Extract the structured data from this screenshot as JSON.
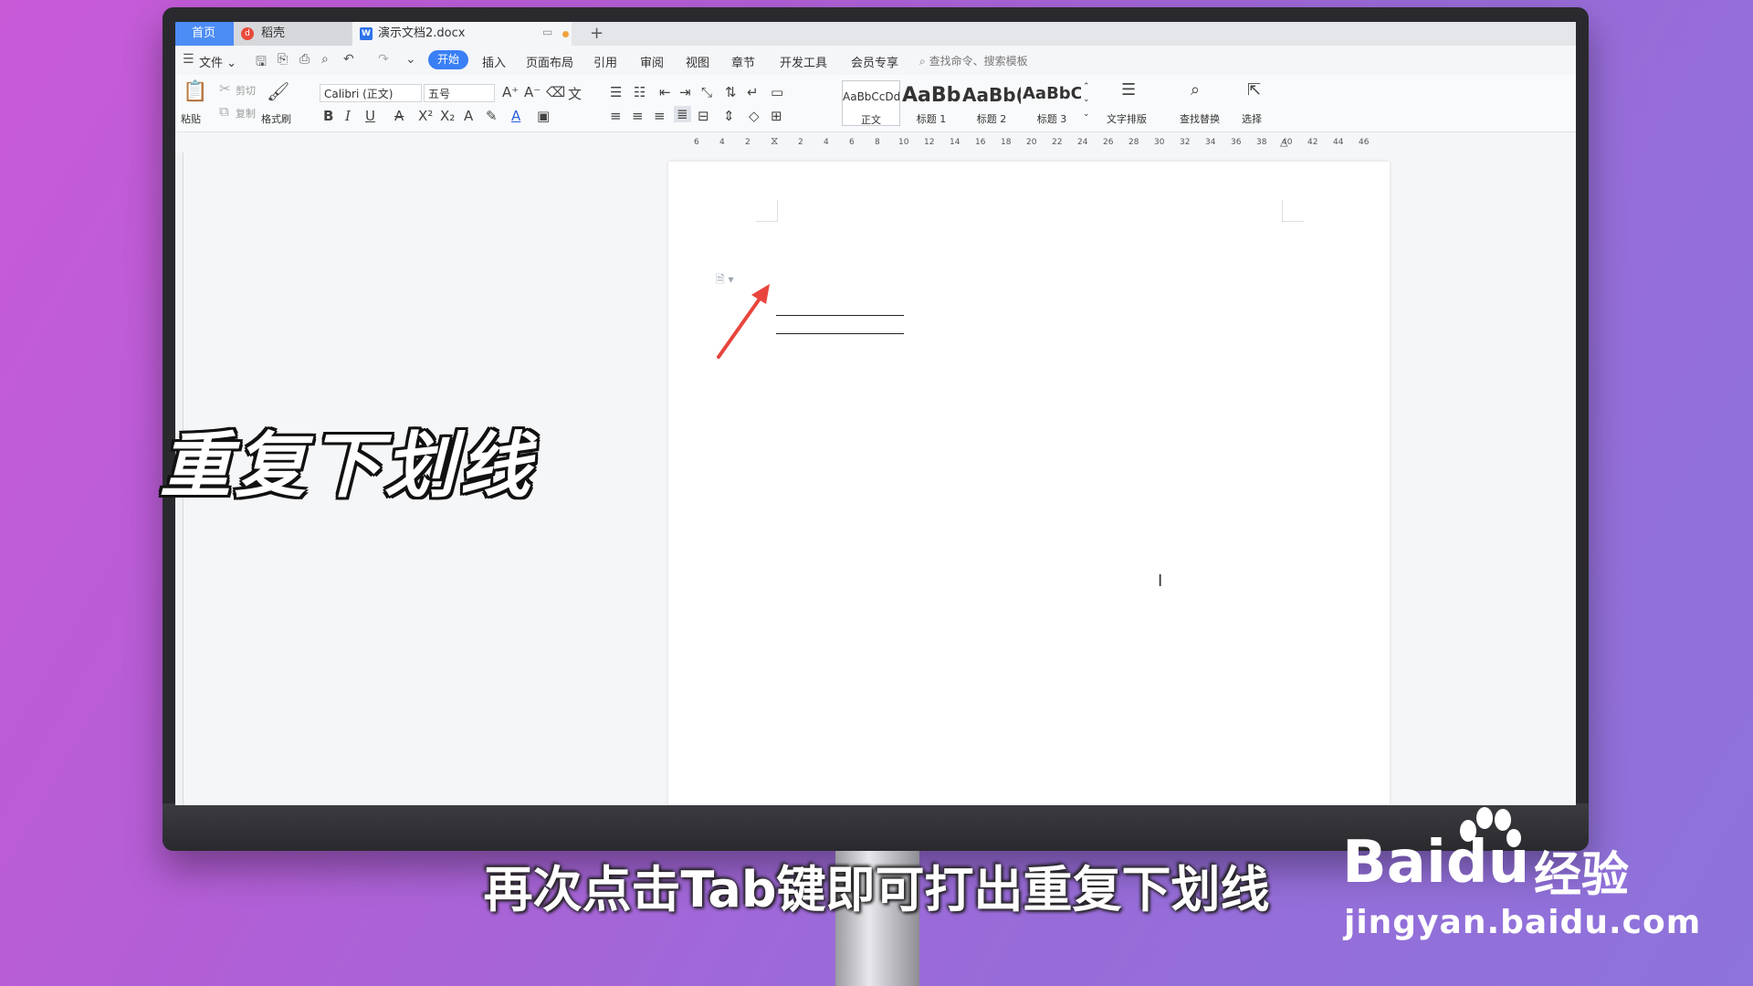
{
  "tabs": {
    "home": "首页",
    "daoke": "稻壳",
    "document": "演示文档2.docx"
  },
  "menu": {
    "file": "文件",
    "items": [
      "开始",
      "插入",
      "页面布局",
      "引用",
      "审阅",
      "视图",
      "章节",
      "开发工具",
      "会员专享"
    ],
    "search_placeholder": "查找命令、搜索模板"
  },
  "ribbon": {
    "paste": "粘贴",
    "cut": "剪切",
    "copy": "复制",
    "format_painter": "格式刷",
    "font_name": "Calibri (正文)",
    "font_size": "五号",
    "styles": [
      {
        "preview": "AaBbCcDd",
        "label": "正文"
      },
      {
        "preview": "AaBb",
        "label": "标题 1"
      },
      {
        "preview": "AaBb(",
        "label": "标题 2"
      },
      {
        "preview": "AaBbC(",
        "label": "标题 3"
      }
    ],
    "text_layout": "文字排版",
    "find_replace": "查找替换",
    "select": "选择"
  },
  "ruler": {
    "numbers": [
      "6",
      "4",
      "2",
      "2",
      "4",
      "6",
      "8",
      "10",
      "12",
      "14",
      "16",
      "18",
      "20",
      "22",
      "24",
      "26",
      "28",
      "30",
      "32",
      "34",
      "36",
      "38",
      "40",
      "42",
      "44",
      "46"
    ]
  },
  "overlay": {
    "title": "重复下划线",
    "subtitle": "再次点击Tab键即可打出重复下划线"
  },
  "watermark": {
    "brand": "Bai",
    "brand_du": "du",
    "jingyan": "经验",
    "url": "jingyan.baidu.com"
  },
  "colors": {
    "accent": "#3a7ff5",
    "arrow": "#e8453c"
  }
}
